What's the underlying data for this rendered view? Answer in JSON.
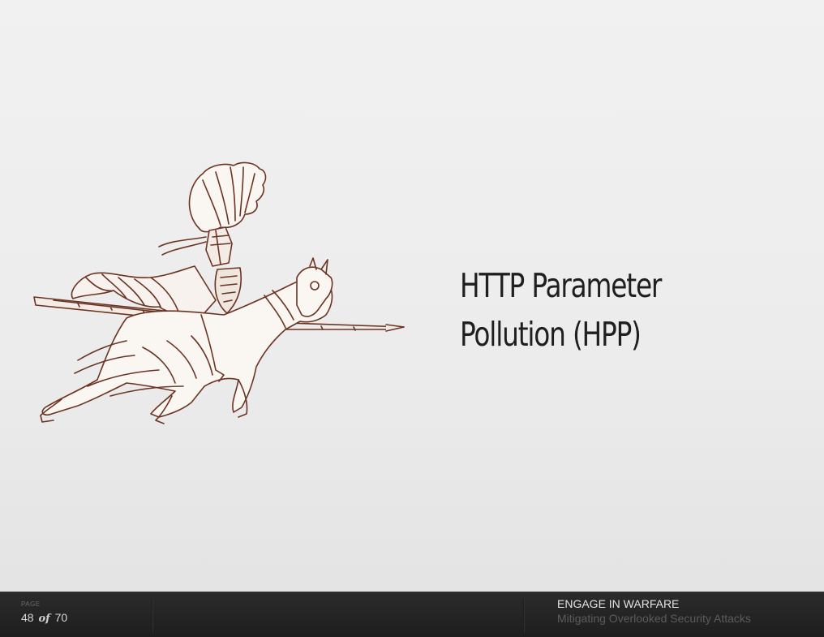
{
  "slide": {
    "title_line1": "HTTP Parameter",
    "title_line2": "Pollution (HPP)",
    "illustration_icon": "jousting-knight-icon"
  },
  "footer": {
    "page_label": "PAGE",
    "current_page": "48",
    "of_label": "of",
    "total_pages": "70",
    "deck_title": "ENGAGE IN WARFARE",
    "deck_subtitle": "Mitigating Overlooked Security  Attacks"
  },
  "colors": {
    "background": "#ececec",
    "footer_background": "#232323",
    "title_text": "#1f1f1f",
    "illustration_ink": "#6b3322"
  }
}
